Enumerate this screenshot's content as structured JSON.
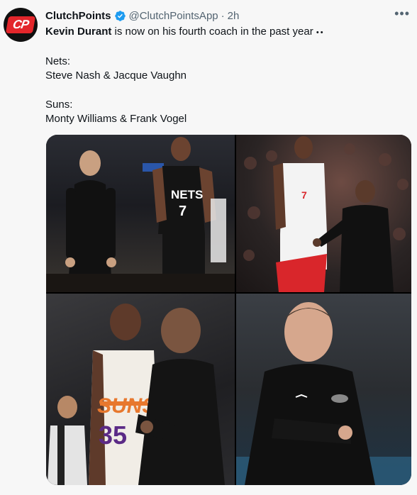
{
  "tweet": {
    "display_name": "ClutchPoints",
    "handle": "@ClutchPointsApp",
    "separator": "·",
    "time": "2h",
    "avatar_text": "CP",
    "more_icon": "more-horizontal-icon",
    "verified_icon": "verified-badge-icon",
    "colors": {
      "verified": "#1d9bf0",
      "avatar_red": "#e3262b",
      "muted": "#536471"
    },
    "body": {
      "mention": "Kevin Durant",
      "line1_rest": " is now on his fourth coach in the past year",
      "line1_emoji": "••",
      "nets_label": "Nets:",
      "nets_coaches": "Steve Nash & Jacque Vaughn",
      "suns_label": "Suns:",
      "suns_coaches": "Monty Williams & Frank Vogel"
    },
    "media": {
      "jersey_nets_text": "NETS",
      "jersey_nets_number": "7",
      "jersey_suns_text": "SUNS",
      "jersey_suns_number": "35"
    }
  }
}
